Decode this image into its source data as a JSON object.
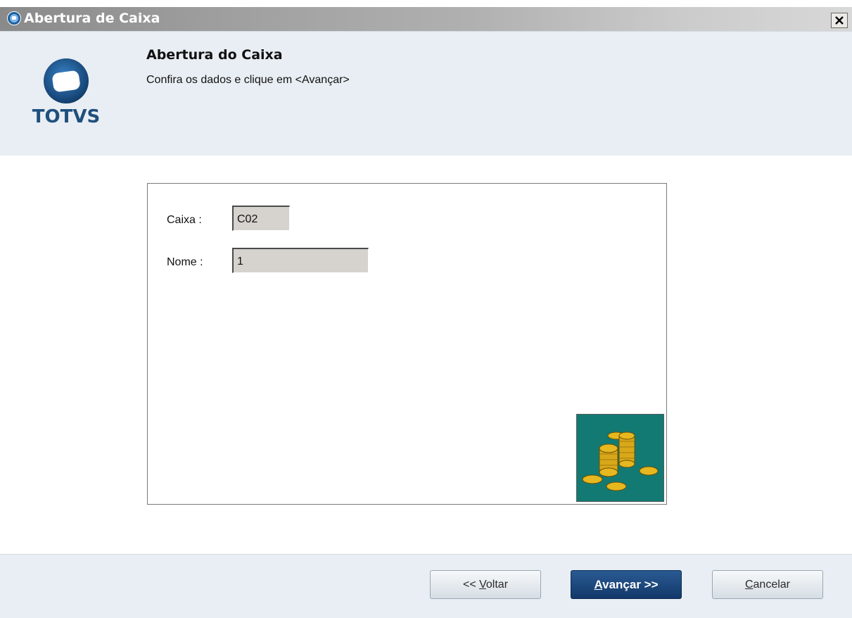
{
  "window": {
    "title": "Abertura de Caixa",
    "close_label": "×"
  },
  "header": {
    "logo_text": "TOTVS",
    "title": "Abertura do Caixa",
    "subtitle": "Confira os dados e clique em <Avançar>"
  },
  "form": {
    "caixa_label": "Caixa :",
    "caixa_value": "C02",
    "nome_label": "Nome  :",
    "nome_value": "1"
  },
  "footer": {
    "back": {
      "prefix": "<< ",
      "accel": "V",
      "rest": "oltar"
    },
    "next": {
      "accel": "A",
      "rest": "vançar >>"
    },
    "cancel": {
      "accel": "C",
      "rest": "ancelar"
    }
  },
  "icons": {
    "app": "totvs-app-icon",
    "close": "close-icon",
    "logo": "totvs-logo",
    "coins": "coins-icon"
  },
  "colors": {
    "titlebar": "#8a8a8a",
    "header_bg": "#e8eef3",
    "primary_button": "#1b4a80",
    "field_bg": "#d6d3ce",
    "coins_bg": "#127a73"
  }
}
